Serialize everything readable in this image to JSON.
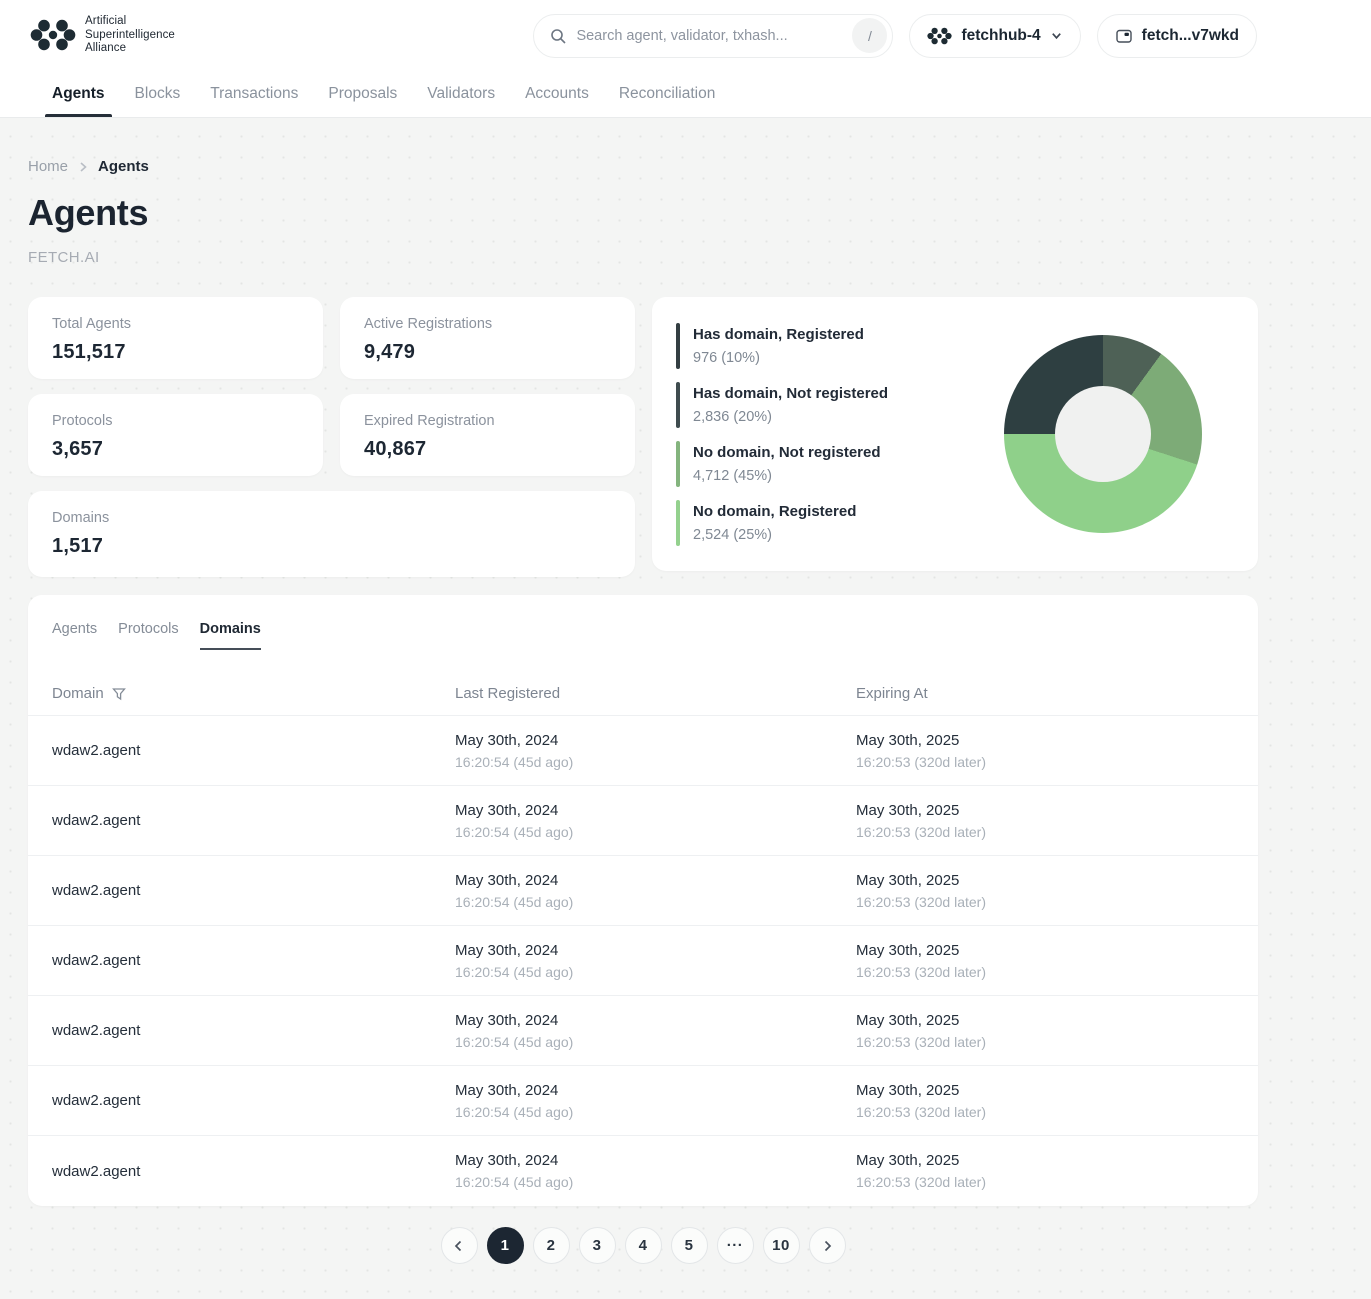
{
  "header": {
    "logo": {
      "line1": "Artificial",
      "line2": "Superintelligence",
      "line3": "Alliance"
    },
    "search": {
      "placeholder": "Search agent, validator, txhash...",
      "shortcut_key": "/"
    },
    "network_selector": {
      "label": "fetchhub-4"
    },
    "wallet": {
      "label": "fetch...v7wkd"
    },
    "nav_items": [
      {
        "label": "Agents",
        "active": true
      },
      {
        "label": "Blocks"
      },
      {
        "label": "Transactions"
      },
      {
        "label": "Proposals"
      },
      {
        "label": "Validators"
      },
      {
        "label": "Accounts"
      },
      {
        "label": "Reconciliation"
      }
    ]
  },
  "breadcrumb": {
    "items": [
      "Home",
      "Agents"
    ]
  },
  "page": {
    "title": "Agents",
    "network_name": "FETCH.AI"
  },
  "stats": {
    "cards": [
      {
        "label": "Total Agents",
        "value": "151,517"
      },
      {
        "label": "Active Registrations",
        "value": "9,479"
      },
      {
        "label": "Protocols",
        "value": "3,657"
      },
      {
        "label": "Expired Registration",
        "value": "40,867"
      },
      {
        "label": "Domains",
        "value": "1,517"
      }
    ]
  },
  "chart_data": {
    "type": "pie",
    "subtype": "donut",
    "title": "",
    "legend_position": "left",
    "hole_color": "#f0f1f0",
    "segments": [
      {
        "label": "Has domain, Registered",
        "value": 976,
        "percent": 10,
        "display": "976 (10%)",
        "slice_color": "#4e6156",
        "legend_color": "#333e42"
      },
      {
        "label": "Has domain, Not registered",
        "value": 2836,
        "percent": 20,
        "display": "2,836 (20%)",
        "slice_color": "#7dab77",
        "legend_color": "#3f4c4f"
      },
      {
        "label": "No domain, Not registered",
        "value": 4712,
        "percent": 45,
        "display": "4,712 (45%)",
        "slice_color": "#8fd08a",
        "legend_color": "#84b47e"
      },
      {
        "label": "No domain, Registered",
        "value": 2524,
        "percent": 25,
        "display": "2,524 (25%)",
        "slice_color": "#2e3f41",
        "legend_color": "#94d18e"
      }
    ]
  },
  "table": {
    "tabs": [
      {
        "label": "Agents"
      },
      {
        "label": "Protocols"
      },
      {
        "label": "Domains",
        "active": true
      }
    ],
    "columns": [
      "Domain",
      "Last Registered",
      "Expiring At"
    ],
    "rows": [
      {
        "domain": "wdaw2.agent",
        "registered_date": "May 30th, 2024",
        "registered_time": "16:20:54 (45d ago)",
        "expiring_date": "May 30th, 2025",
        "expiring_time": "16:20:53 (320d later)"
      },
      {
        "domain": "wdaw2.agent",
        "registered_date": "May 30th, 2024",
        "registered_time": "16:20:54 (45d ago)",
        "expiring_date": "May 30th, 2025",
        "expiring_time": "16:20:53 (320d later)"
      },
      {
        "domain": "wdaw2.agent",
        "registered_date": "May 30th, 2024",
        "registered_time": "16:20:54 (45d ago)",
        "expiring_date": "May 30th, 2025",
        "expiring_time": "16:20:53 (320d later)"
      },
      {
        "domain": "wdaw2.agent",
        "registered_date": "May 30th, 2024",
        "registered_time": "16:20:54 (45d ago)",
        "expiring_date": "May 30th, 2025",
        "expiring_time": "16:20:53 (320d later)"
      },
      {
        "domain": "wdaw2.agent",
        "registered_date": "May 30th, 2024",
        "registered_time": "16:20:54 (45d ago)",
        "expiring_date": "May 30th, 2025",
        "expiring_time": "16:20:53 (320d later)"
      },
      {
        "domain": "wdaw2.agent",
        "registered_date": "May 30th, 2024",
        "registered_time": "16:20:54 (45d ago)",
        "expiring_date": "May 30th, 2025",
        "expiring_time": "16:20:53 (320d later)"
      },
      {
        "domain": "wdaw2.agent",
        "registered_date": "May 30th, 2024",
        "registered_time": "16:20:54 (45d ago)",
        "expiring_date": "May 30th, 2025",
        "expiring_time": "16:20:53 (320d later)"
      }
    ]
  },
  "pagination": {
    "pages": [
      "1",
      "2",
      "3",
      "4",
      "5",
      "···",
      "10"
    ],
    "active_page": "1"
  }
}
